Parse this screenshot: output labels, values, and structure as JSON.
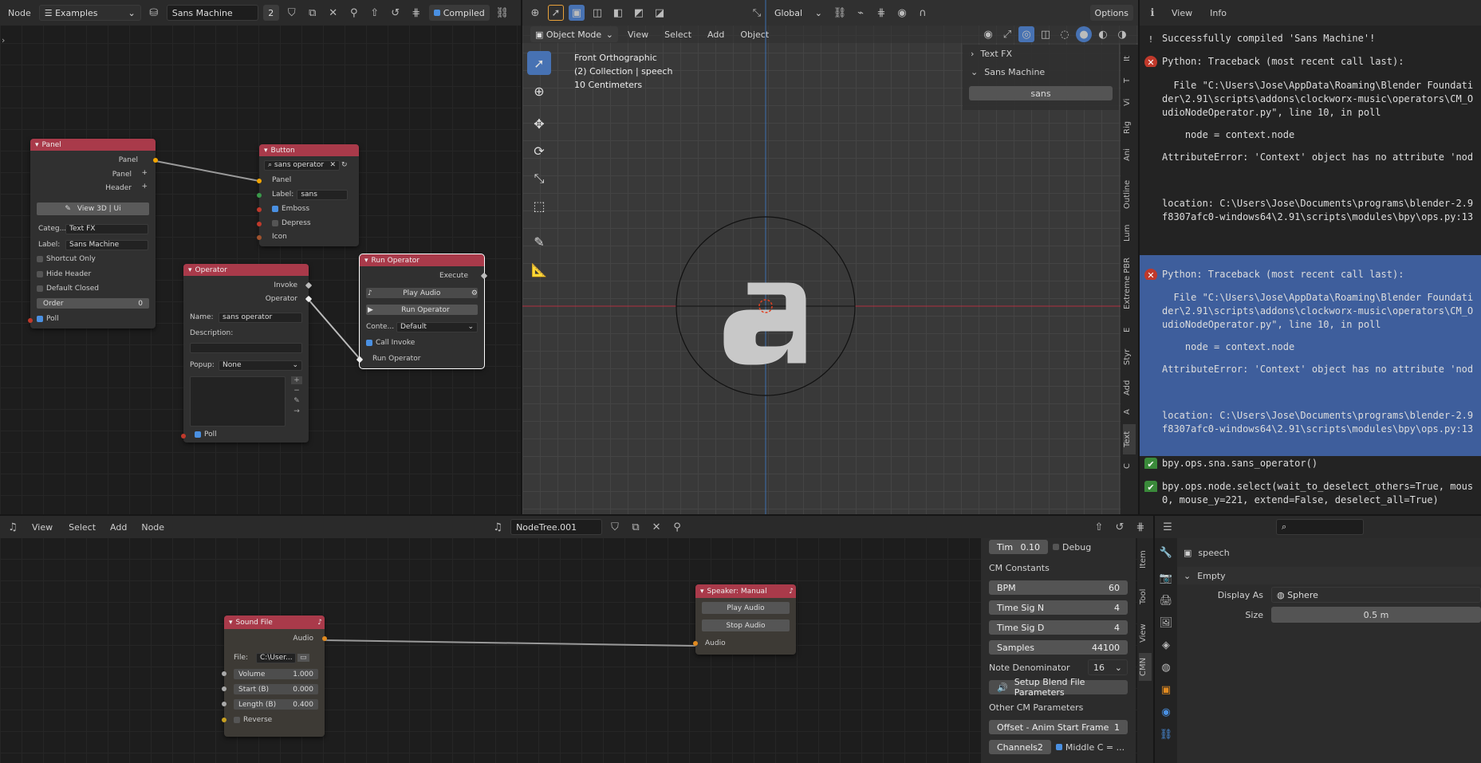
{
  "top_node": {
    "editor_label": "Node",
    "tree_type": "Examples",
    "tree_name": "Sans Machine",
    "users": "2",
    "compiled_label": "Compiled"
  },
  "nodes": {
    "panel": {
      "title": "Panel",
      "out_panel": "Panel",
      "panel_label": "Panel",
      "header_label": "Header",
      "view_button": "View 3D | Ui",
      "categ_label": "Categ...",
      "categ_value": "Text FX",
      "label_label": "Label:",
      "label_value": "Sans Machine",
      "shortcut_only": "Shortcut Only",
      "hide_header": "Hide Header",
      "default_closed": "Default Closed",
      "order_label": "Order",
      "order_value": "0",
      "poll": "Poll"
    },
    "button": {
      "title": "Button",
      "operator_value": "sans operator",
      "in_panel": "Panel",
      "label_label": "Label:",
      "label_value": "sans",
      "emboss": "Emboss",
      "depress": "Depress",
      "icon": "Icon"
    },
    "operator": {
      "title": "Operator",
      "invoke": "Invoke",
      "out_operator": "Operator",
      "name_label": "Name:",
      "name_value": "sans operator",
      "description_label": "Description:",
      "popup_label": "Popup:",
      "popup_value": "None",
      "poll": "Poll"
    },
    "run_operator": {
      "title": "Run Operator",
      "execute": "Execute",
      "play_audio": "Play Audio",
      "run_operator_btn": "Run Operator",
      "context_label": "Conte...",
      "context_value": "Default",
      "call_invoke": "Call Invoke",
      "in_run_operator": "Run Operator"
    }
  },
  "viewport": {
    "mode": "Object Mode",
    "menus": [
      "View",
      "Select",
      "Add",
      "Object"
    ],
    "orientation": "Global",
    "options": "Options",
    "info_lines": [
      "Front Orthographic",
      "(2) Collection | speech",
      "10 Centimeters"
    ],
    "npanel_text_fx": "Text FX",
    "npanel_sans_machine": "Sans Machine",
    "npanel_sans_button": "sans",
    "tabs": [
      "It",
      "T",
      "Vi",
      "Rig",
      "Ani",
      "Outline",
      "Lum",
      "Extreme PBR",
      "E",
      "Styr",
      "Add",
      "A",
      "Text",
      "C"
    ]
  },
  "info_editor": {
    "menus": [
      "View",
      "Info"
    ],
    "lines": [
      {
        "type": "info",
        "text": "Successfully compiled 'Sans Machine'!"
      },
      {
        "type": "error",
        "text": "Python: Traceback (most recent call last):"
      },
      {
        "type": "plain",
        "text": "  File \"C:\\Users\\Jose\\AppData\\Roaming\\Blender Foundati"
      },
      {
        "type": "plain",
        "text": "der\\2.91\\scripts\\addons\\clockworx-music\\operators\\CM_O"
      },
      {
        "type": "plain",
        "text": "udioNodeOperator.py\", line 10, in poll"
      },
      {
        "type": "plain",
        "text": "    node = context.node"
      },
      {
        "type": "plain",
        "text": "AttributeError: 'Context' object has no attribute 'nod"
      },
      {
        "type": "plain",
        "text": "location: C:\\Users\\Jose\\Documents\\programs\\blender-2.9"
      },
      {
        "type": "plain",
        "text": "f8307afc0-windows64\\2.91\\scripts\\modules\\bpy\\ops.py:13"
      },
      {
        "type": "error_sel",
        "text": "Python: Traceback (most recent call last):"
      },
      {
        "type": "sel",
        "text": "  File \"C:\\Users\\Jose\\AppData\\Roaming\\Blender Foundati"
      },
      {
        "type": "sel",
        "text": "der\\2.91\\scripts\\addons\\clockworx-music\\operators\\CM_O"
      },
      {
        "type": "sel",
        "text": "udioNodeOperator.py\", line 10, in poll"
      },
      {
        "type": "sel",
        "text": "    node = context.node"
      },
      {
        "type": "sel",
        "text": "AttributeError: 'Context' object has no attribute 'nod"
      },
      {
        "type": "sel",
        "text": "location: C:\\Users\\Jose\\Documents\\programs\\blender-2.9"
      },
      {
        "type": "sel",
        "text": "f8307afc0-windows64\\2.91\\scripts\\modules\\bpy\\ops.py:13"
      },
      {
        "type": "op",
        "text": "bpy.ops.sna.sans_operator()"
      },
      {
        "type": "op",
        "text": "bpy.ops.node.select(wait_to_deselect_others=True, mous"
      },
      {
        "type": "plain",
        "text": "0, mouse_y=221, extend=False, deselect_all=True)"
      }
    ]
  },
  "audio_node": {
    "menus": [
      "View",
      "Select",
      "Add",
      "Node"
    ],
    "tree_name": "NodeTree.001",
    "sound_file": {
      "title": "Sound File",
      "audio": "Audio",
      "file_label": "File:",
      "file_value": "C:\\User...",
      "volume_label": "Volume",
      "volume_value": "1.000",
      "start_label": "Start (B)",
      "start_value": "0.000",
      "length_label": "Length (B)",
      "length_value": "0.400",
      "reverse": "Reverse"
    },
    "speaker": {
      "title": "Speaker: Manual",
      "play": "Play Audio",
      "stop": "Stop Audio",
      "audio": "Audio"
    },
    "npanel": {
      "tim_label": "Tim",
      "tim_value": "0.10",
      "debug": "Debug",
      "cm_constants": "CM Constants",
      "bpm_label": "BPM",
      "bpm_value": "60",
      "tsn_label": "Time Sig N",
      "tsn_value": "4",
      "tsd_label": "Time Sig D",
      "tsd_value": "4",
      "samples_label": "Samples",
      "samples_value": "44100",
      "note_den_label": "Note Denominator",
      "note_den_value": "16",
      "setup_btn": "Setup Blend File Parameters",
      "other_params": "Other CM Parameters",
      "offset_label": "Offset - Anim Start Frame",
      "offset_value": "1",
      "channels_label": "Channels",
      "channels_value": "2",
      "middle_c": "Middle C = ..."
    },
    "tabs": [
      "Item",
      "Tool",
      "View",
      "CMN"
    ]
  },
  "properties": {
    "object_name": "speech",
    "section": "Empty",
    "display_as_label": "Display As",
    "display_as_value": "Sphere",
    "size_label": "Size",
    "size_value": "0.5 m"
  }
}
